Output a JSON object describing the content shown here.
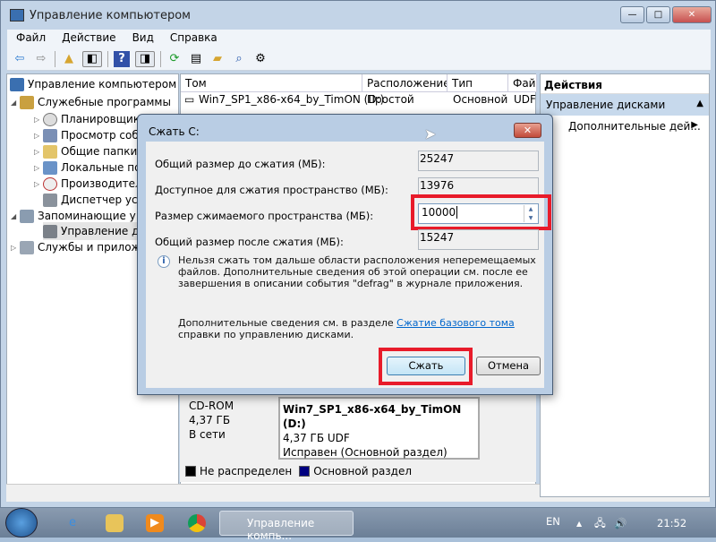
{
  "window": {
    "title": "Управление компьютером"
  },
  "menu": [
    "Файл",
    "Действие",
    "Вид",
    "Справка"
  ],
  "toolbar": [
    "back-icon",
    "forward-icon",
    "up-icon",
    "show-hide-tree-icon",
    "help-icon",
    "show-hide-action-icon",
    "refresh-icon",
    "properties-icon",
    "open-icon",
    "search-icon",
    "settings-icon"
  ],
  "tree": {
    "root": "Управление компьютером (л",
    "items": [
      {
        "label": "Служебные программы"
      },
      {
        "label": "Планировщик"
      },
      {
        "label": "Просмотр соб"
      },
      {
        "label": "Общие папки"
      },
      {
        "label": "Локальные пол"
      },
      {
        "label": "Производител"
      },
      {
        "label": "Диспетчер устр"
      },
      {
        "label": "Запоминающие у"
      },
      {
        "label": "Управление ди"
      },
      {
        "label": "Службы и прилож"
      }
    ]
  },
  "volumes": {
    "headers": [
      "Том",
      "Расположение",
      "Тип",
      "Фай"
    ],
    "rows": [
      {
        "name": "Win7_SP1_x86-x64_by_TimON (D:)",
        "layout": "Простой",
        "type": "Основной",
        "fs": "UDF"
      }
    ]
  },
  "actions": {
    "title": "Действия",
    "section": "Управление дисками",
    "item": "Дополнительные дей..."
  },
  "disk": {
    "type": "CD-ROM",
    "size": "4,37 ГБ",
    "status": "В сети",
    "partition": {
      "name": "Win7_SP1_x86-x64_by_TimON  (D:)",
      "size": "4,37 ГБ UDF",
      "state": "Исправен (Основной раздел)"
    }
  },
  "legend": {
    "unallocated": "Не распределен",
    "primary": "Основной раздел",
    "colors": {
      "unallocated": "#000000",
      "primary": "#000080"
    }
  },
  "dialog": {
    "title": "Сжать C:",
    "total_before_label": "Общий размер до сжатия (МБ):",
    "total_before": "25247",
    "available_label": "Доступное для сжатия пространство (МБ):",
    "available": "13976",
    "shrink_label": "Размер сжимаемого пространства (МБ):",
    "shrink_value": "10000",
    "total_after_label": "Общий размер после сжатия (МБ):",
    "total_after": "15247",
    "note1": "Нельзя сжать том дальше области расположения неперемещаемых файлов. Дополнительные сведения об этой операции см. после ее завершения в описании события \"defrag\" в журнале приложения.",
    "note2_pre": "Дополнительные сведения см. в разделе ",
    "note2_link": "Сжатие базового тома",
    "note2_post": " справки по управлению дисками.",
    "ok": "Сжать",
    "cancel": "Отмена"
  },
  "taskbar": {
    "task": "Управление компь...",
    "lang": "EN",
    "clock": "21:52"
  }
}
